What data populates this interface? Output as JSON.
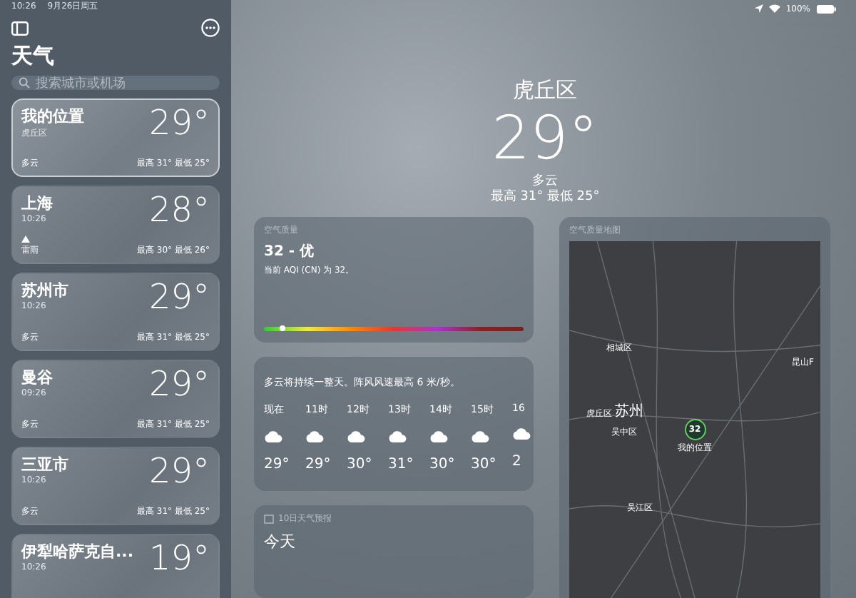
{
  "status_bar": {
    "time": "10:26",
    "date": "9月26日周五",
    "battery": "100%"
  },
  "sidebar": {
    "title": "天气",
    "search": {
      "placeholder": "搜索城市或机场"
    },
    "cities": [
      {
        "name": "我的位置",
        "subtitle": "虎丘区",
        "temp": "29°",
        "condition": "多云",
        "range": "最高 31° 最低 25°",
        "selected": true,
        "alert": false
      },
      {
        "name": "上海",
        "subtitle": "10:26",
        "temp": "28°",
        "condition": "雷雨",
        "range": "最高 30° 最低 26°",
        "selected": false,
        "alert": true
      },
      {
        "name": "苏州市",
        "subtitle": "10:26",
        "temp": "29°",
        "condition": "多云",
        "range": "最高 31° 最低 25°",
        "selected": false,
        "alert": false
      },
      {
        "name": "曼谷",
        "subtitle": "09:26",
        "temp": "29°",
        "condition": "多云",
        "range": "最高 31° 最低 25°",
        "selected": false,
        "alert": false
      },
      {
        "name": "三亚市",
        "subtitle": "10:26",
        "temp": "29°",
        "condition": "多云",
        "range": "最高 31° 最低 25°",
        "selected": false,
        "alert": false
      },
      {
        "name": "伊犁哈萨克自...",
        "subtitle": "10:26",
        "temp": "19°",
        "selected": false
      }
    ]
  },
  "current": {
    "place": "虎丘区",
    "temp": "29°",
    "condition": "多云",
    "range": "最高 31° 最低 25°"
  },
  "air_quality": {
    "header": "空气质量",
    "value": "32 - 优",
    "description": "当前 AQI (CN) 为 32。",
    "level": 0.07
  },
  "hourly": {
    "summary": "多云将持续一整天。阵风风速最高 6 米/秒。",
    "hours": [
      {
        "time": "现在",
        "temp": "29°"
      },
      {
        "time": "11时",
        "temp": "29°"
      },
      {
        "time": "12时",
        "temp": "30°"
      },
      {
        "time": "13时",
        "temp": "31°"
      },
      {
        "time": "14时",
        "temp": "30°"
      },
      {
        "time": "15时",
        "temp": "30°"
      },
      {
        "time": "16",
        "temp": "2"
      }
    ]
  },
  "forecast": {
    "header": "10日天气预报",
    "day": "今天"
  },
  "air_map": {
    "header": "空气质量地图",
    "labels": [
      {
        "text": "相城区",
        "kind": "district"
      },
      {
        "text": "昆山F",
        "kind": "district"
      },
      {
        "text": "虎丘区",
        "kind": "district"
      },
      {
        "text": "苏州",
        "kind": "city"
      },
      {
        "text": "吴中区",
        "kind": "district"
      },
      {
        "text": "吴江区",
        "kind": "district"
      }
    ],
    "pin": {
      "value": "32",
      "label": "我的位置"
    }
  }
}
